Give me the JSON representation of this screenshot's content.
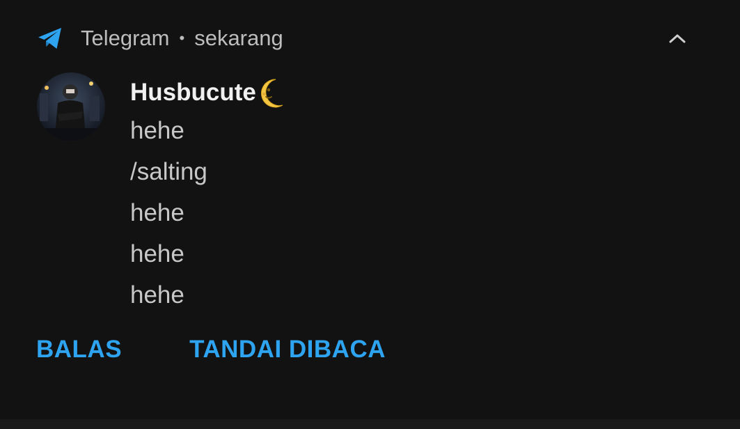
{
  "header": {
    "app_name": "Telegram",
    "separator": "•",
    "time": "sekarang",
    "app_icon": "telegram-icon",
    "collapse_icon": "chevron-up-icon"
  },
  "notification": {
    "sender": "Husbucute",
    "sender_emoji_icon": "crescent-moon-face-icon",
    "messages": [
      "hehe",
      "/salting",
      "hehe",
      "hehe",
      "hehe"
    ]
  },
  "actions": {
    "reply_label": "BALAS",
    "mark_read_label": "TANDAI DIBACA"
  },
  "colors": {
    "accent": "#2ea3f0",
    "background": "#121212",
    "primary_text": "#f0f0f0",
    "secondary_text": "#c8c8c8"
  }
}
